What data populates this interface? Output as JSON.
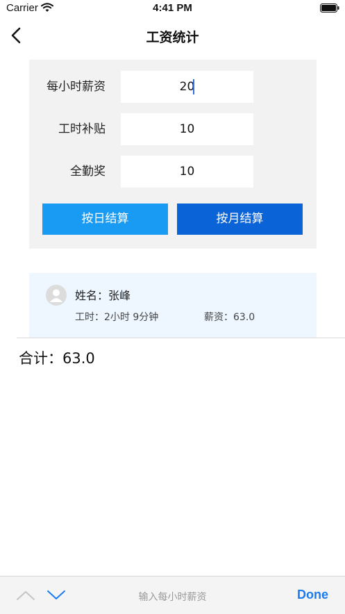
{
  "status_bar": {
    "carrier": "Carrier",
    "time": "4:41 PM"
  },
  "nav": {
    "title": "工资统计"
  },
  "form": {
    "hourly_rate": {
      "label": "每小时薪资",
      "value": "20"
    },
    "hour_subsidy": {
      "label": "工时补贴",
      "value": "10"
    },
    "attendance_bonus": {
      "label": "全勤奖",
      "value": "10"
    },
    "daily_button": "按日结算",
    "monthly_button": "按月结算"
  },
  "record": {
    "name": "姓名：张峰",
    "hours": "工时：2小时 9分钟",
    "salary": "薪资：63.0"
  },
  "total": "合计：63.0",
  "keyboard_toolbar": {
    "hint": "输入每小时薪资",
    "done": "Done"
  },
  "colors": {
    "primary_light": "#1a9bf3",
    "primary_dark": "#0b63d8",
    "done": "#1a7bf0"
  }
}
